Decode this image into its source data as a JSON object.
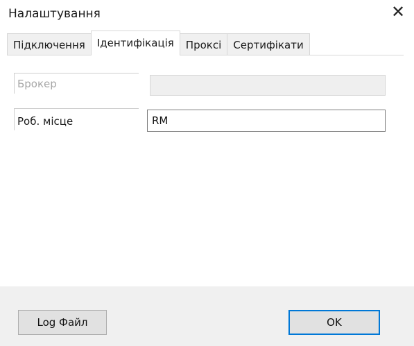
{
  "window": {
    "title": "Налаштування",
    "close_glyph": "✕"
  },
  "tabs": [
    {
      "label": "Підключення",
      "active": false
    },
    {
      "label": "Ідентифікація",
      "active": true
    },
    {
      "label": "Проксі",
      "active": false
    },
    {
      "label": "Сертифікати",
      "active": false
    }
  ],
  "form": {
    "broker": {
      "label": "Брокер",
      "value": "",
      "enabled": false
    },
    "workplace": {
      "label": "Роб. місце",
      "value": "RM",
      "enabled": true
    }
  },
  "footer": {
    "log_button": "Log Файл",
    "ok_button": "OK"
  },
  "colors": {
    "default_button_border": "#0078d7",
    "footer_bg": "#f0f0f0",
    "disabled_text": "#a6a6a6"
  }
}
